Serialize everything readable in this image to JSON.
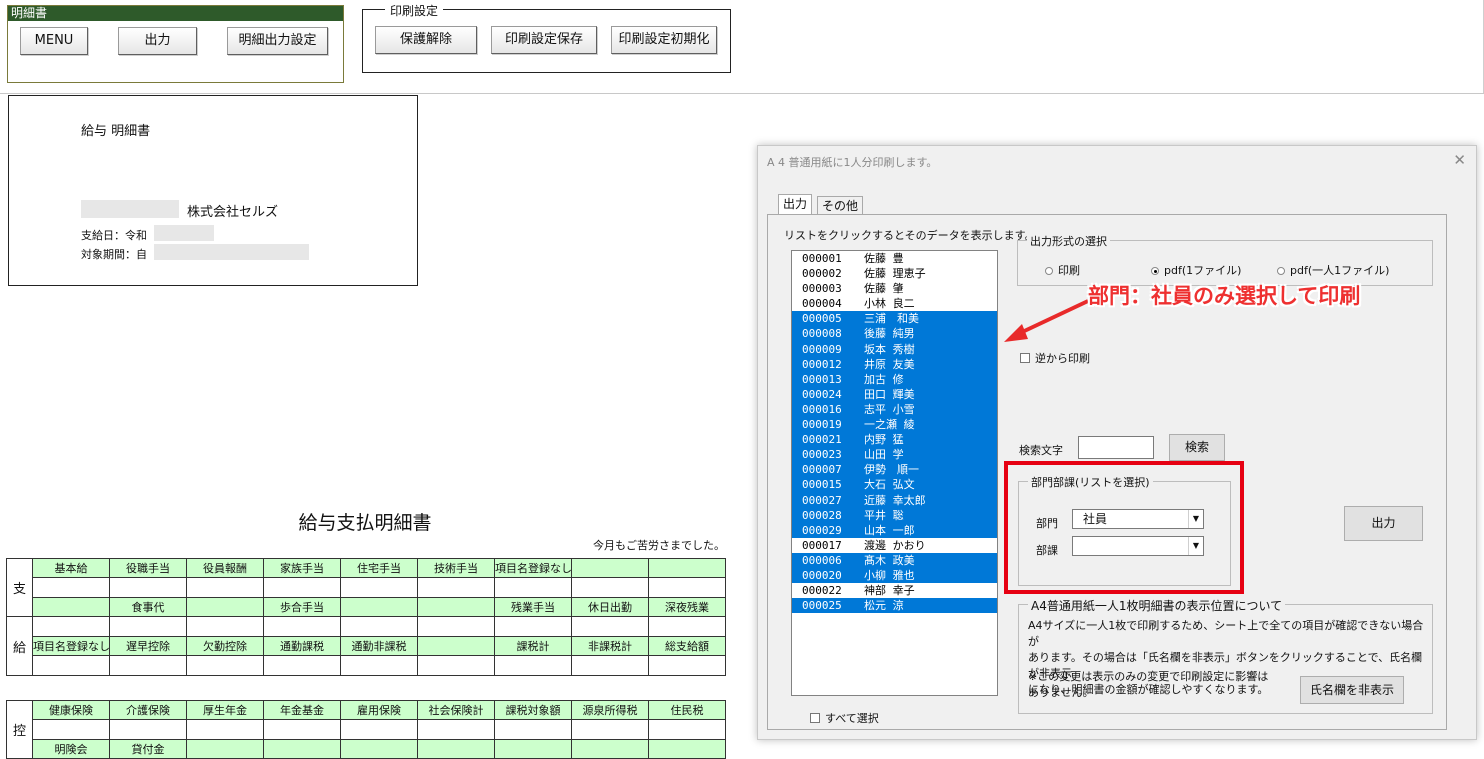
{
  "top": {
    "panel_title": "明細書",
    "buttons": [
      "MENU",
      "出力",
      "明細出力設定"
    ],
    "print_group": {
      "legend": "印刷設定",
      "buttons": [
        "保護解除",
        "印刷設定保存",
        "印刷設定初期化"
      ]
    }
  },
  "header": {
    "title": "給与 明細書",
    "company": "株式会社セルズ",
    "pay_date": "支給日：令和",
    "period": "対象期間：自"
  },
  "slip": {
    "title": "給与支払明細書",
    "subtitle": "今月もご苦労さまでした。",
    "pay_side": [
      "支",
      "給"
    ],
    "pay_rows": [
      [
        "基本給",
        "役職手当",
        "役員報酬",
        "家族手当",
        "住宅手当",
        "技術手当",
        "項目名登録なし",
        "",
        ""
      ],
      [
        "",
        "食事代",
        "",
        "歩合手当",
        "",
        "",
        "残業手当",
        "休日出勤",
        "深夜残業"
      ],
      [
        "項目名登録なし",
        "遅早控除",
        "欠勤控除",
        "通勤課税",
        "通勤非課税",
        "",
        "課税計",
        "非課税計",
        "総支給額"
      ]
    ],
    "ded_side": "控",
    "ded_rows": [
      [
        "健康保険",
        "介護保険",
        "厚生年金",
        "年金基金",
        "雇用保険",
        "社会保険計",
        "課税対象額",
        "源泉所得税",
        "住民税"
      ],
      [
        "明険会",
        "貸付金",
        "",
        "",
        "",
        "",
        "",
        "",
        ""
      ]
    ]
  },
  "dialog": {
    "title": "A 4 普通用紙に1人分印刷します。",
    "close": "✕",
    "tabs": [
      "出力",
      "その他"
    ],
    "list_hint": "リストをクリックするとそのデータを表示します。",
    "employees": [
      {
        "code": "000001",
        "name": "佐藤 豊",
        "selected": false
      },
      {
        "code": "000002",
        "name": "佐藤 理恵子",
        "selected": false
      },
      {
        "code": "000003",
        "name": "佐藤 肇",
        "selected": false
      },
      {
        "code": "000004",
        "name": "小林 良二",
        "selected": false
      },
      {
        "code": "000005",
        "name": "三浦　和美",
        "selected": true
      },
      {
        "code": "000008",
        "name": "後藤 純男",
        "selected": true
      },
      {
        "code": "000009",
        "name": "坂本 秀樹",
        "selected": true
      },
      {
        "code": "000012",
        "name": "井原 友美",
        "selected": true
      },
      {
        "code": "000013",
        "name": "加古 修",
        "selected": true
      },
      {
        "code": "000024",
        "name": "田口 輝美",
        "selected": true
      },
      {
        "code": "000016",
        "name": "志平 小雪",
        "selected": true
      },
      {
        "code": "000019",
        "name": "一之瀬 綾",
        "selected": true
      },
      {
        "code": "000021",
        "name": "内野 猛",
        "selected": true
      },
      {
        "code": "000023",
        "name": "山田 学",
        "selected": true
      },
      {
        "code": "000007",
        "name": "伊勢　順一",
        "selected": true
      },
      {
        "code": "000015",
        "name": "大石 弘文",
        "selected": true
      },
      {
        "code": "000027",
        "name": "近藤 幸太郎",
        "selected": true
      },
      {
        "code": "000028",
        "name": "平井 聡",
        "selected": true
      },
      {
        "code": "000029",
        "name": "山本 一郎",
        "selected": true
      },
      {
        "code": "000017",
        "name": "渡邊 かおり",
        "selected": false
      },
      {
        "code": "000006",
        "name": "髙木 政美",
        "selected": true
      },
      {
        "code": "000020",
        "name": "小柳 雅也",
        "selected": true
      },
      {
        "code": "000022",
        "name": "神部 幸子",
        "selected": false
      },
      {
        "code": "000025",
        "name": "松元 涼",
        "selected": true
      }
    ],
    "select_all": "すべて選択",
    "output_format": {
      "legend": "出力形式の選択",
      "options": [
        "印刷",
        "pdf(1ファイル)",
        "pdf(一人1ファイル)"
      ],
      "selected_index": 1
    },
    "reverse_print": "逆から印刷",
    "search_label": "検索文字",
    "search_value": "",
    "search_button": "検索",
    "dept_group": {
      "legend": "部門部課(リストを選択)",
      "dept_label": "部門",
      "dept_value": "社員",
      "section_label": "部課",
      "section_value": ""
    },
    "output_button": "出力",
    "display_group": {
      "legend": "A4普通用紙一人1枚明細書の表示位置について",
      "lines": [
        "A4サイズに一人1枚で印刷するため、シート上で全ての項目が確認できない場合が",
        "あります。その場合は「氏名欄を非表示」ボタンをクリックすることで、氏名欄が非表示",
        "になり、明細書の金額が確認しやすくなります。"
      ],
      "note_lines": [
        "※この変更は表示のみの変更で印刷設定に影響は",
        "ありません。"
      ],
      "hide_button": "氏名欄を非表示"
    }
  },
  "annotation": {
    "text": "部門：社員のみ選択して印刷",
    "color": "#ee3030"
  },
  "colors": {
    "header_green": "#2e5a2a",
    "cell_green": "#ccffcc",
    "selection_blue": "#0078d7",
    "highlight_red": "#e60012"
  }
}
